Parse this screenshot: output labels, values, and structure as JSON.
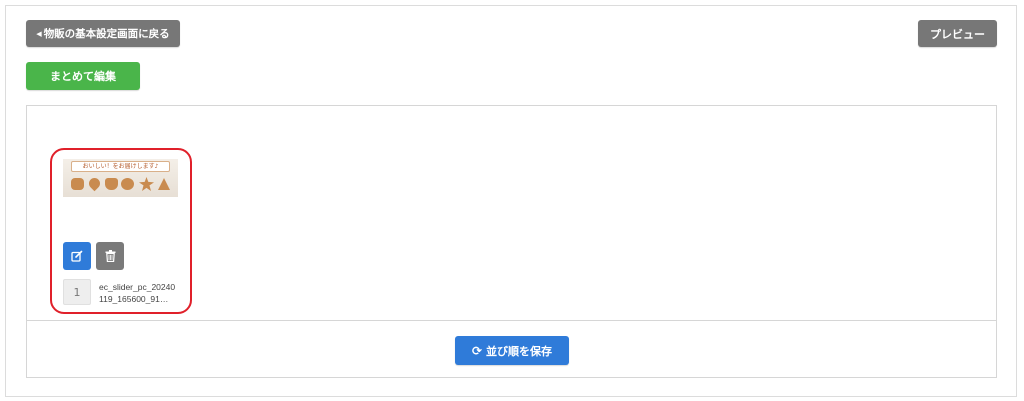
{
  "toolbar": {
    "back_label": "物販の基本設定画面に戻る",
    "preview_label": "プレビュー",
    "bulk_edit_label": "まとめて編集"
  },
  "slider": {
    "items": [
      {
        "order": "1",
        "filename": "ec_slider_pc_20240119_165600_91…",
        "thumbnail_caption": "おいしい！をお届けします♪",
        "edit_icon": "edit-icon",
        "delete_icon": "trash-icon"
      }
    ],
    "save_order_label": "並び順を保存",
    "save_icon": "refresh-icon"
  },
  "colors": {
    "gray_button": "#777777",
    "green_button": "#4ab54a",
    "blue_button": "#2f7bd9",
    "highlight_border": "#e0202a"
  }
}
